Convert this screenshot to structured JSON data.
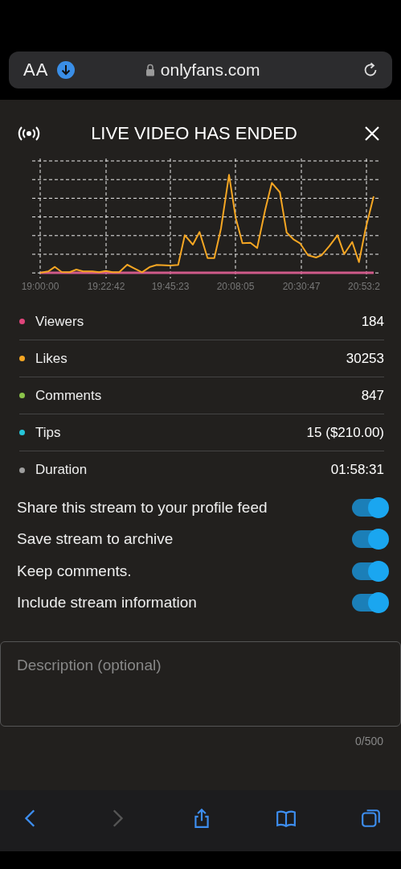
{
  "browser": {
    "text_size": "AA",
    "url": "onlyfans.com"
  },
  "panel": {
    "title": "LIVE VIDEO HAS ENDED"
  },
  "chart": {
    "x_labels": [
      "19:00:00",
      "19:22:42",
      "19:45:23",
      "20:08:05",
      "20:30:47",
      "20:53:2"
    ]
  },
  "stats": [
    {
      "label": "Viewers",
      "value": "184",
      "color": "#e0457b"
    },
    {
      "label": "Likes",
      "value": "30253",
      "color": "#f5a623"
    },
    {
      "label": "Comments",
      "value": "847",
      "color": "#8bc34a"
    },
    {
      "label": "Tips",
      "value": "15 ($210.00)",
      "color": "#26c6da"
    },
    {
      "label": "Duration",
      "value": "01:58:31",
      "color": "#9e9e9e"
    }
  ],
  "options": [
    {
      "label": "Share this stream to your profile feed",
      "on": true
    },
    {
      "label": "Save stream to archive",
      "on": true
    },
    {
      "label": "Keep comments.",
      "on": true
    },
    {
      "label": "Include stream information",
      "on": true
    }
  ],
  "description": {
    "placeholder": "Description (optional)",
    "counter": "0/500"
  },
  "toolbar": [
    {
      "kind": "back",
      "disabled": false
    },
    {
      "kind": "forward",
      "disabled": true
    },
    {
      "kind": "share",
      "disabled": false
    },
    {
      "kind": "bookmarks",
      "disabled": false
    },
    {
      "kind": "tabs",
      "disabled": false
    }
  ]
}
